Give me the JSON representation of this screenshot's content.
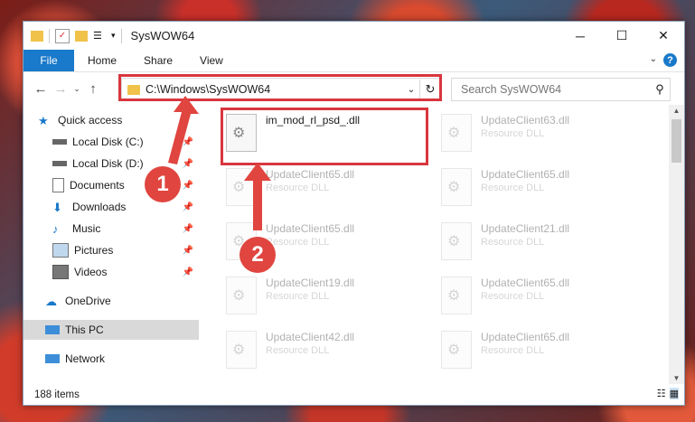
{
  "window": {
    "title": "SysWOW64"
  },
  "window_controls": {
    "minimize": "─",
    "maximize": "☐",
    "close": "✕"
  },
  "ribbon": {
    "file": "File",
    "tabs": [
      "Home",
      "Share",
      "View"
    ],
    "help": "?"
  },
  "address": {
    "path": "C:\\Windows\\SysWOW64"
  },
  "search": {
    "placeholder": "Search SysWOW64"
  },
  "nav": {
    "items": [
      {
        "label": "Quick access",
        "icon": "star-icon"
      },
      {
        "label": "Local Disk (C:)",
        "icon": "drive-icon"
      },
      {
        "label": "Local Disk (D:)",
        "icon": "drive-icon"
      },
      {
        "label": "Documents",
        "icon": "documents-icon"
      },
      {
        "label": "Downloads",
        "icon": "downloads-icon"
      },
      {
        "label": "Music",
        "icon": "music-icon"
      },
      {
        "label": "Pictures",
        "icon": "pictures-icon"
      },
      {
        "label": "Videos",
        "icon": "videos-icon"
      },
      {
        "label": "OneDrive",
        "icon": "cloud-icon"
      },
      {
        "label": "This PC",
        "icon": "computer-icon"
      },
      {
        "label": "Network",
        "icon": "network-icon"
      }
    ]
  },
  "files": [
    {
      "name": "im_mod_rl_psd_.dll",
      "type": ""
    },
    {
      "name": "UpdateClient63.dll",
      "type": "Resource DLL"
    },
    {
      "name": "UpdateClient65.dll",
      "type": "Resource DLL"
    },
    {
      "name": "UpdateClient65.dll",
      "type": "Resource DLL"
    },
    {
      "name": "UpdateClient65.dll",
      "type": "Resource DLL"
    },
    {
      "name": "UpdateClient21.dll",
      "type": "Resource DLL"
    },
    {
      "name": "UpdateClient19.dll",
      "type": "Resource DLL"
    },
    {
      "name": "UpdateClient65.dll",
      "type": "Resource DLL"
    },
    {
      "name": "UpdateClient42.dll",
      "type": "Resource DLL"
    },
    {
      "name": "UpdateClient65.dll",
      "type": "Resource DLL"
    }
  ],
  "status": {
    "item_count": "188 items"
  },
  "annotations": {
    "marker1": "1",
    "marker2": "2",
    "accent": "#d9363e"
  }
}
